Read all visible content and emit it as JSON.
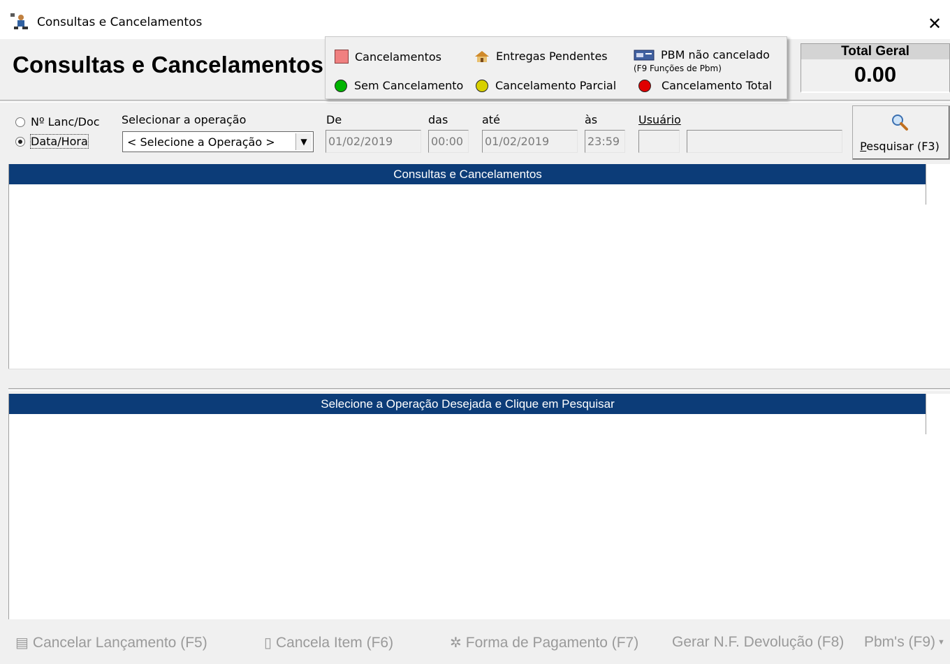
{
  "window": {
    "title": "Consultas e Cancelamentos",
    "close_glyph": "✕"
  },
  "header": {
    "big_title": "Consultas e Cancelamentos"
  },
  "legend": {
    "cancelamentos": "Cancelamentos",
    "entregas": "Entregas Pendentes",
    "pbm": "PBM não cancelado",
    "pbm_sub": "(F9 Funções de Pbm)",
    "sem_cancelamento": "Sem Cancelamento",
    "parcial": "Cancelamento Parcial",
    "total": "Cancelamento Total",
    "colors": {
      "red_square": "#f08080",
      "green": "#00b400",
      "yellow": "#d8d000",
      "red": "#e00000"
    }
  },
  "total": {
    "label": "Total Geral",
    "value": "0.00"
  },
  "filters": {
    "radio_lanc": "Nº Lanc/Doc",
    "radio_data": "Data/Hora",
    "selected_radio": "Data/Hora",
    "op_label": "Selecionar a operação",
    "op_value": "< Selecione a Operação >",
    "de_label": "De",
    "de_value": "01/02/2019",
    "das_label": "das",
    "das_value": "00:00",
    "ate_label": "até",
    "ate_value": "01/02/2019",
    "as_label": "às",
    "as_value": "23:59",
    "usuario_label": "Usuário",
    "usuario_code": "",
    "usuario_name": ""
  },
  "search_button": {
    "label_first": "P",
    "label_rest": "esquisar (F3)",
    "icon": "magnifier-icon"
  },
  "grids": {
    "top_header": "Consultas e Cancelamentos",
    "bottom_header": "Selecione a Operação Desejada e Clique em Pesquisar"
  },
  "toolbar": {
    "cancelar_lanc": "Cancelar Lançamento (F5)",
    "cancela_item": "Cancela Item (F6)",
    "forma_pagamento": "Forma de Pagamento (F7)",
    "gerar_nf": "Gerar N.F. Devolução (F8)",
    "pbms": "Pbm's (F9)"
  }
}
